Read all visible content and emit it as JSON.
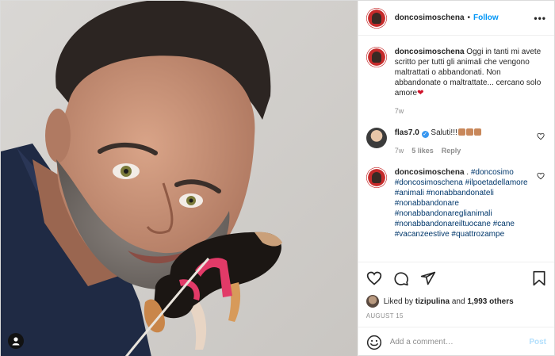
{
  "post": {
    "username": "doncosimoschena",
    "follow_label": "Follow",
    "more_label": "•••"
  },
  "caption": {
    "username": "doncosimoschena",
    "text": "Oggi in tanti mi avete scritto per tutti gli animali che vengono maltrattati o abbandonati. Non abbandonate o maltrattate... cercano solo amore",
    "heart": "❤",
    "age": "7w"
  },
  "comments": [
    {
      "username": "flas7.0",
      "verified": true,
      "text": "Saluti!!!",
      "age": "7w",
      "likes": "5 likes",
      "reply": "Reply"
    },
    {
      "username": "doncosimoschena",
      "text": ".",
      "hashtags": [
        "#doncosimo",
        "#doncosimoschena",
        "#ilpoetadellamore",
        "#animali",
        "#nonabbandonateli",
        "#nonabbandonare",
        "#nonabbandonareglianimali",
        "#nonabbandonareiltuocane",
        "#cane",
        "#vacanzeestive",
        "#quattrozampe"
      ]
    }
  ],
  "likes": {
    "prefix": "Liked by ",
    "user": "tizipulina",
    "middle": " and ",
    "count": "1,993 others"
  },
  "date": "AUGUST 15",
  "add_comment": {
    "placeholder": "Add a comment…",
    "post_label": "Post"
  },
  "icons": {
    "user_tag": "user-icon",
    "like": "heart-icon",
    "comment": "comment-icon",
    "share": "share-icon",
    "save": "bookmark-icon",
    "emoji": "smiley-icon"
  },
  "colors": {
    "accent": "#0095f6",
    "hashtag": "#00376b",
    "heart": "#ed4956",
    "post_disabled": "#b2dffc"
  }
}
